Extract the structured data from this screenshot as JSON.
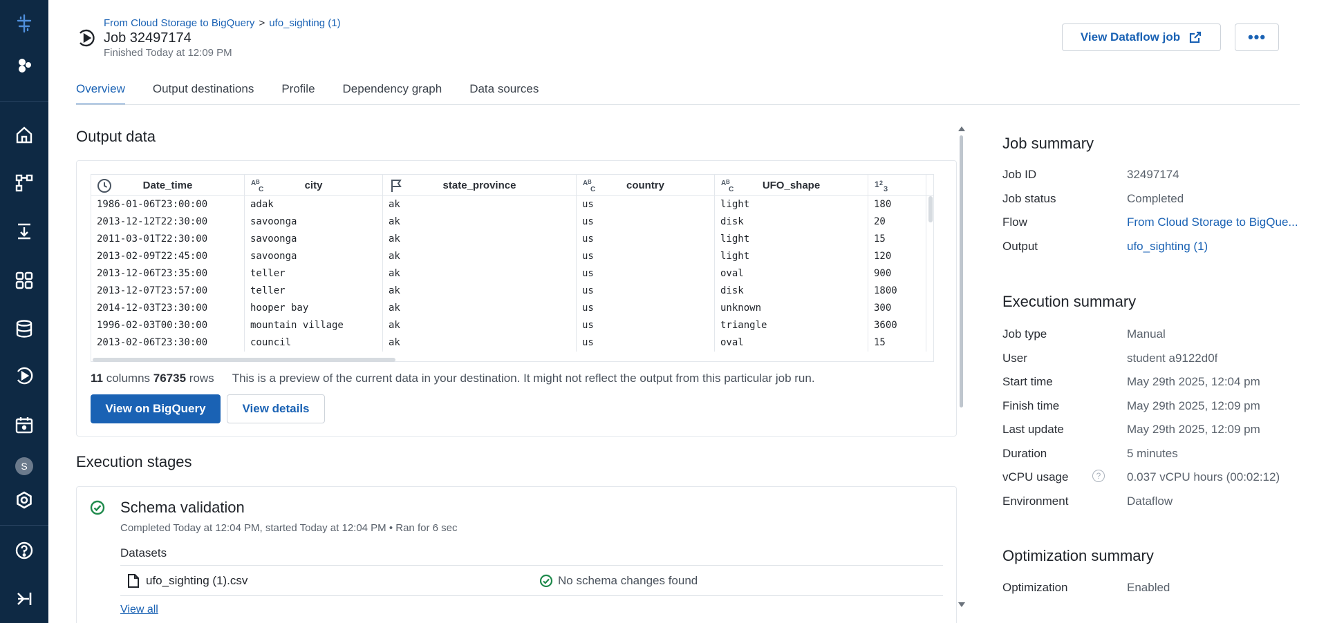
{
  "nav": {
    "items": [
      {
        "name": "logo-icon"
      },
      {
        "name": "apps-icon"
      },
      {
        "name": "home-icon"
      },
      {
        "name": "flows-icon"
      },
      {
        "name": "imports-icon"
      },
      {
        "name": "library-icon"
      },
      {
        "name": "connections-icon"
      },
      {
        "name": "jobs-icon"
      },
      {
        "name": "schedule-icon"
      },
      {
        "name": "settings-icon"
      },
      {
        "name": "help-icon"
      },
      {
        "name": "expand-icon"
      }
    ],
    "avatar_initial": "S"
  },
  "header": {
    "breadcrumb": [
      "From Cloud Storage to BigQuery",
      "ufo_sighting (1)"
    ],
    "breadcrumb_sep": ">",
    "title": "Job 32497174",
    "subtitle": "Finished Today at 12:09 PM",
    "view_dataflow_label": "View Dataflow job",
    "more_label": "•••"
  },
  "tabs": [
    "Overview",
    "Output destinations",
    "Profile",
    "Dependency graph",
    "Data sources"
  ],
  "output": {
    "title": "Output data",
    "columns": [
      {
        "name": "Date_time",
        "type_icon": "clock-icon"
      },
      {
        "name": "city",
        "type_icon": "abc-icon"
      },
      {
        "name": "state_province",
        "type_icon": "flag-icon"
      },
      {
        "name": "country",
        "type_icon": "abc-icon"
      },
      {
        "name": "UFO_shape",
        "type_icon": "abc-icon"
      },
      {
        "name": "",
        "type_icon": "number-icon"
      }
    ],
    "rows": [
      [
        "1986-01-06T23:00:00",
        "adak",
        "ak",
        "us",
        "light",
        "180"
      ],
      [
        "2013-12-12T22:30:00",
        "savoonga",
        "ak",
        "us",
        "disk",
        "20"
      ],
      [
        "2011-03-01T22:30:00",
        "savoonga",
        "ak",
        "us",
        "light",
        "15"
      ],
      [
        "2013-02-09T22:45:00",
        "savoonga",
        "ak",
        "us",
        "light",
        "120"
      ],
      [
        "2013-12-06T23:35:00",
        "teller",
        "ak",
        "us",
        "oval",
        "900"
      ],
      [
        "2013-12-07T23:57:00",
        "teller",
        "ak",
        "us",
        "disk",
        "1800"
      ],
      [
        "2014-12-03T23:30:00",
        "hooper bay",
        "ak",
        "us",
        "unknown",
        "300"
      ],
      [
        "1996-02-03T00:30:00",
        "mountain village",
        "ak",
        "us",
        "triangle",
        "3600"
      ],
      [
        "2013-02-06T23:30:00",
        "council",
        "ak",
        "us",
        "oval",
        "15"
      ]
    ],
    "columns_count": "11",
    "columns_word": "columns",
    "rows_count": "76735",
    "rows_word": "rows",
    "preview_note": "This is a preview of the current data in your destination. It might not reflect the output from this particular job run.",
    "view_bigquery_label": "View on BigQuery",
    "view_details_label": "View details"
  },
  "stages": {
    "title": "Execution stages",
    "items": [
      {
        "title": "Schema validation",
        "meta": "Completed Today at 12:04 PM, started Today at 12:04 PM • Ran for 6 sec",
        "datasets_label": "Datasets",
        "dataset_name": "ufo_sighting (1).csv",
        "dataset_status": "No schema changes found",
        "view_all": "View all"
      }
    ]
  },
  "job_summary": {
    "title": "Job summary",
    "fields": [
      {
        "label": "Job ID",
        "value": "32497174"
      },
      {
        "label": "Job status",
        "value": "Completed"
      },
      {
        "label": "Flow",
        "value": "From Cloud Storage to BigQue..."
      },
      {
        "label": "Output",
        "value": "ufo_sighting (1)"
      }
    ]
  },
  "execution_summary": {
    "title": "Execution summary",
    "fields": [
      {
        "label": "Job type",
        "value": "Manual"
      },
      {
        "label": "User",
        "value": "student a9122d0f"
      },
      {
        "label": "Start time",
        "value": "May 29th 2025, 12:04 pm"
      },
      {
        "label": "Finish time",
        "value": "May 29th 2025, 12:09 pm"
      },
      {
        "label": "Last update",
        "value": "May 29th 2025, 12:09 pm"
      },
      {
        "label": "Duration",
        "value": "5 minutes"
      },
      {
        "label": "vCPU usage",
        "value": "0.037 vCPU hours (00:02:12)"
      },
      {
        "label": "Environment",
        "value": "Dataflow"
      }
    ],
    "help_glyph": "?"
  },
  "optimization_summary": {
    "title": "Optimization summary",
    "fields": [
      {
        "label": "Optimization",
        "value": "Enabled"
      }
    ]
  },
  "colors": {
    "rail": "#0e2944",
    "accent": "#1a62b4",
    "success": "#1f8a4c"
  }
}
